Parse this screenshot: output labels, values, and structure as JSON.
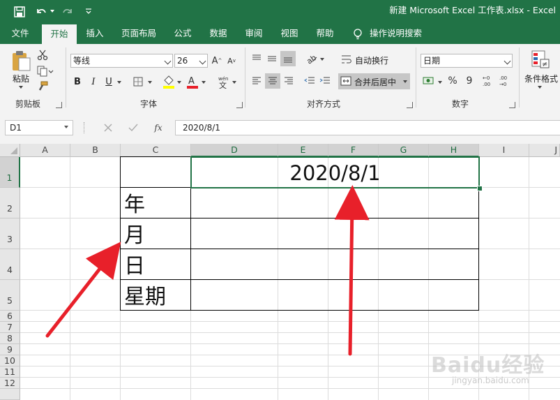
{
  "titlebar": {
    "title": "新建 Microsoft Excel 工作表.xlsx  -  Excel"
  },
  "tabs": [
    {
      "label": "文件"
    },
    {
      "label": "开始"
    },
    {
      "label": "插入"
    },
    {
      "label": "页面布局"
    },
    {
      "label": "公式"
    },
    {
      "label": "数据"
    },
    {
      "label": "审阅"
    },
    {
      "label": "视图"
    },
    {
      "label": "帮助"
    }
  ],
  "tell_me": {
    "label": "操作说明搜索"
  },
  "ribbon": {
    "clipboard": {
      "paste_label": "粘贴",
      "group_label": "剪贴板"
    },
    "font": {
      "font_name": "等线",
      "font_size": "26",
      "group_label": "字体",
      "bold": "B",
      "italic": "I",
      "underline": "U"
    },
    "alignment": {
      "wrap_text": "自动换行",
      "merge_center": "合并后居中",
      "group_label": "对齐方式"
    },
    "number": {
      "format": "日期",
      "group_label": "数字",
      "percent": "%",
      "comma": "9"
    },
    "styles": {
      "conditional_format": "条件格式"
    }
  },
  "formula_bar": {
    "name_box": "D1",
    "fx": "fx",
    "value": "2020/8/1"
  },
  "sheet": {
    "columns": [
      "A",
      "B",
      "C",
      "D",
      "E",
      "F",
      "G",
      "H",
      "I",
      "J"
    ],
    "rows": [
      "1",
      "2",
      "3",
      "4",
      "5",
      "6",
      "7",
      "8",
      "9",
      "10",
      "11",
      "12"
    ],
    "cells": {
      "D1": "2020/8/1",
      "C2": "年",
      "C3": "月",
      "C4": "日",
      "C5": "星期"
    }
  },
  "watermark": {
    "brand": "Baidu经验",
    "url": "jingyan.baidu.com"
  },
  "colors": {
    "excel_green": "#217346",
    "arrow_red": "#e8202a"
  }
}
